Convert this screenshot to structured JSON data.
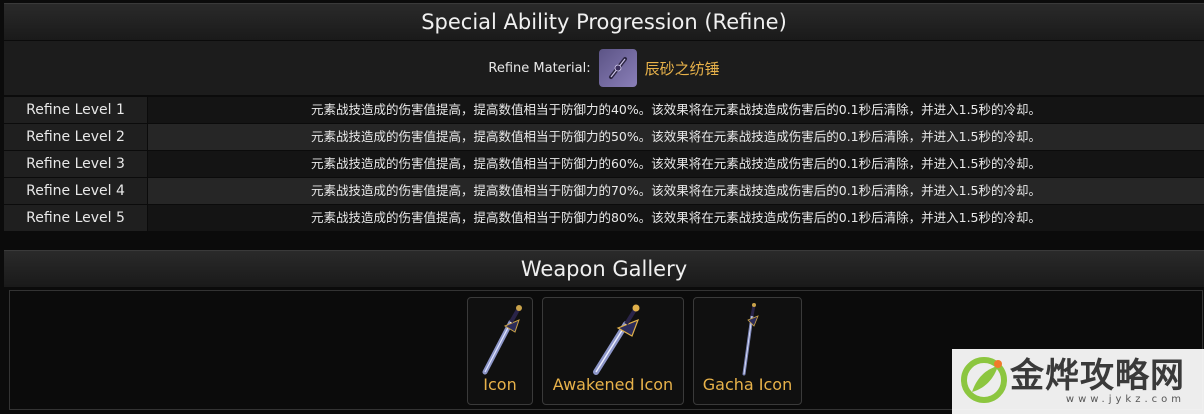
{
  "refine": {
    "title": "Special Ability Progression (Refine)",
    "material_label": "Refine Material:",
    "material_name": "辰砂之纺锤",
    "levels": [
      {
        "label": "Refine Level 1",
        "desc": "元素战技造成的伤害值提高，提高数值相当于防御力的40%。该效果将在元素战技造成伤害后的0.1秒后清除，并进入1.5秒的冷却。"
      },
      {
        "label": "Refine Level 2",
        "desc": "元素战技造成的伤害值提高，提高数值相当于防御力的50%。该效果将在元素战技造成伤害后的0.1秒后清除，并进入1.5秒的冷却。"
      },
      {
        "label": "Refine Level 3",
        "desc": "元素战技造成的伤害值提高，提高数值相当于防御力的60%。该效果将在元素战技造成伤害后的0.1秒后清除，并进入1.5秒的冷却。"
      },
      {
        "label": "Refine Level 4",
        "desc": "元素战技造成的伤害值提高，提高数值相当于防御力的70%。该效果将在元素战技造成伤害后的0.1秒后清除，并进入1.5秒的冷却。"
      },
      {
        "label": "Refine Level 5",
        "desc": "元素战技造成的伤害值提高，提高数值相当于防御力的80%。该效果将在元素战技造成伤害后的0.1秒后清除，并进入1.5秒的冷却。"
      }
    ]
  },
  "gallery": {
    "title": "Weapon Gallery",
    "items": [
      {
        "caption": "Icon",
        "icon": "sword-icon"
      },
      {
        "caption": "Awakened Icon",
        "icon": "sword-awakened-icon"
      },
      {
        "caption": "Gacha Icon",
        "icon": "sword-gacha-icon"
      }
    ]
  },
  "watermark": {
    "main": "金烨攻略网",
    "sub": "www.jykz.com"
  },
  "colors": {
    "accent": "#e8b24a",
    "background": "#0b0b0b",
    "header": "#222222",
    "row_dark": "#141414",
    "row_light": "#262626"
  }
}
